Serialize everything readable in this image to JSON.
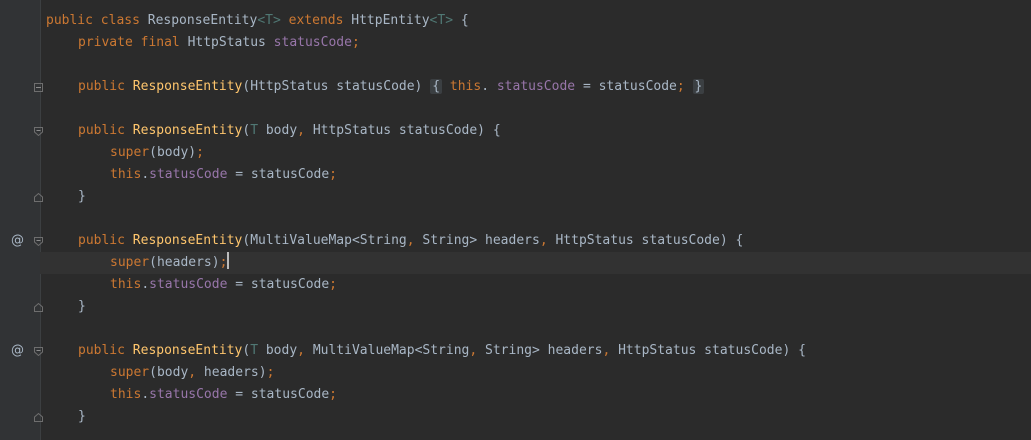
{
  "editor": {
    "annotation_symbol": "@",
    "lines": [
      [
        [
          "kw",
          "public class "
        ],
        [
          "",
          "ResponseEntity"
        ],
        [
          "tp",
          "<T>"
        ],
        [
          "kw",
          " extends "
        ],
        [
          "",
          "HttpEntity"
        ],
        [
          "tp",
          "<T>"
        ],
        [
          "",
          " {"
        ]
      ],
      [
        [
          "kw",
          "private final "
        ],
        [
          "",
          "HttpStatus "
        ],
        [
          "fld",
          "statusCode"
        ],
        [
          "kw",
          ";"
        ]
      ],
      [],
      [
        [
          "kw",
          "public "
        ],
        [
          "fn",
          "ResponseEntity"
        ],
        [
          "",
          "(HttpStatus statusCode) "
        ],
        [
          "fold",
          "{"
        ],
        [
          "",
          " "
        ],
        [
          "kw",
          "this"
        ],
        [
          "",
          ". "
        ],
        [
          "fld",
          "statusCode"
        ],
        [
          "",
          " = statusCode"
        ],
        [
          "kw",
          ";"
        ],
        [
          "",
          " "
        ],
        [
          "fold",
          "}"
        ]
      ],
      [],
      [
        [
          "kw",
          "public "
        ],
        [
          "fn",
          "ResponseEntity"
        ],
        [
          "",
          "("
        ],
        [
          "tp",
          "T"
        ],
        [
          "",
          " body"
        ],
        [
          "kw",
          ","
        ],
        [
          "",
          " HttpStatus statusCode) {"
        ]
      ],
      [
        [
          "kw",
          "super"
        ],
        [
          "",
          "(body)"
        ],
        [
          "kw",
          ";"
        ]
      ],
      [
        [
          "kw",
          "this"
        ],
        [
          "",
          "."
        ],
        [
          "fld",
          "statusCode"
        ],
        [
          "",
          " = statusCode"
        ],
        [
          "kw",
          ";"
        ]
      ],
      [
        [
          "",
          "}"
        ]
      ],
      [],
      [
        [
          "kw",
          "public "
        ],
        [
          "fn",
          "ResponseEntity"
        ],
        [
          "",
          "(MultiValueMap<String"
        ],
        [
          "kw",
          ","
        ],
        [
          "",
          " String> headers"
        ],
        [
          "kw",
          ","
        ],
        [
          "",
          " HttpStatus statusCode) {"
        ]
      ],
      [
        [
          "kw",
          "super"
        ],
        [
          "",
          "(headers)"
        ],
        [
          "kw",
          ";"
        ]
      ],
      [
        [
          "kw",
          "this"
        ],
        [
          "",
          "."
        ],
        [
          "fld",
          "statusCode"
        ],
        [
          "",
          " = statusCode"
        ],
        [
          "kw",
          ";"
        ]
      ],
      [
        [
          "",
          "}"
        ]
      ],
      [],
      [
        [
          "kw",
          "public "
        ],
        [
          "fn",
          "ResponseEntity"
        ],
        [
          "",
          "("
        ],
        [
          "tp",
          "T"
        ],
        [
          "",
          " body"
        ],
        [
          "kw",
          ","
        ],
        [
          "",
          " MultiValueMap<String"
        ],
        [
          "kw",
          ","
        ],
        [
          "",
          " String> headers"
        ],
        [
          "kw",
          ","
        ],
        [
          "",
          " HttpStatus statusCode) {"
        ]
      ],
      [
        [
          "kw",
          "super"
        ],
        [
          "",
          "(body"
        ],
        [
          "kw",
          ","
        ],
        [
          "",
          " headers)"
        ],
        [
          "kw",
          ";"
        ]
      ],
      [
        [
          "kw",
          "this"
        ],
        [
          "",
          "."
        ],
        [
          "fld",
          "statusCode"
        ],
        [
          "",
          " = statusCode"
        ],
        [
          "kw",
          ";"
        ]
      ],
      [
        [
          "",
          "}"
        ]
      ]
    ]
  },
  "colors": {
    "background": "#2b2b2b",
    "gutter": "#313335",
    "keyword": "#cc7832",
    "method": "#ffc66d",
    "field": "#9876aa",
    "type_param": "#507874",
    "text": "#a9b7c6",
    "intention_bulb": "#f0c020"
  }
}
